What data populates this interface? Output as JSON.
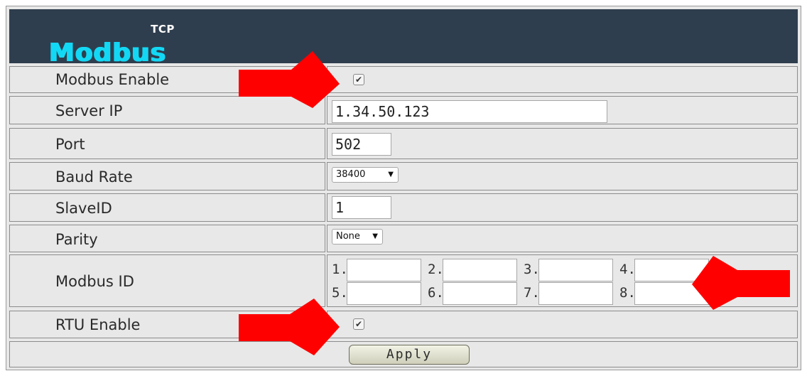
{
  "logo": {
    "small": "TCP",
    "main": "Modbus"
  },
  "rows": {
    "modbus_enable": {
      "label": "Modbus Enable",
      "checked": true,
      "check_glyph": "✔"
    },
    "server_ip": {
      "label": "Server IP",
      "value": "1.34.50.123"
    },
    "port": {
      "label": "Port",
      "value": "502"
    },
    "baud_rate": {
      "label": "Baud Rate",
      "selected": "38400",
      "arrow": "▼"
    },
    "slave_id": {
      "label": "SlaveID",
      "value": "1"
    },
    "parity": {
      "label": "Parity",
      "selected": "None",
      "arrow": "▼"
    },
    "modbus_id": {
      "label": "Modbus ID",
      "fields": [
        {
          "num": "1.",
          "value": ""
        },
        {
          "num": "2.",
          "value": ""
        },
        {
          "num": "3.",
          "value": ""
        },
        {
          "num": "4.",
          "value": ""
        },
        {
          "num": "5.",
          "value": ""
        },
        {
          "num": "6.",
          "value": ""
        },
        {
          "num": "7.",
          "value": ""
        },
        {
          "num": "8.",
          "value": ""
        }
      ]
    },
    "rtu_enable": {
      "label": "RTU Enable",
      "checked": true,
      "check_glyph": "✔"
    }
  },
  "apply_label": "Apply",
  "colors": {
    "header": "#2f3e4e",
    "logo": "#13d8f5",
    "arrow": "#ff0000",
    "panel": "#e8e8e8"
  },
  "annotations": [
    "red-arrow-icon",
    "red-arrow-icon",
    "red-arrow-icon"
  ]
}
